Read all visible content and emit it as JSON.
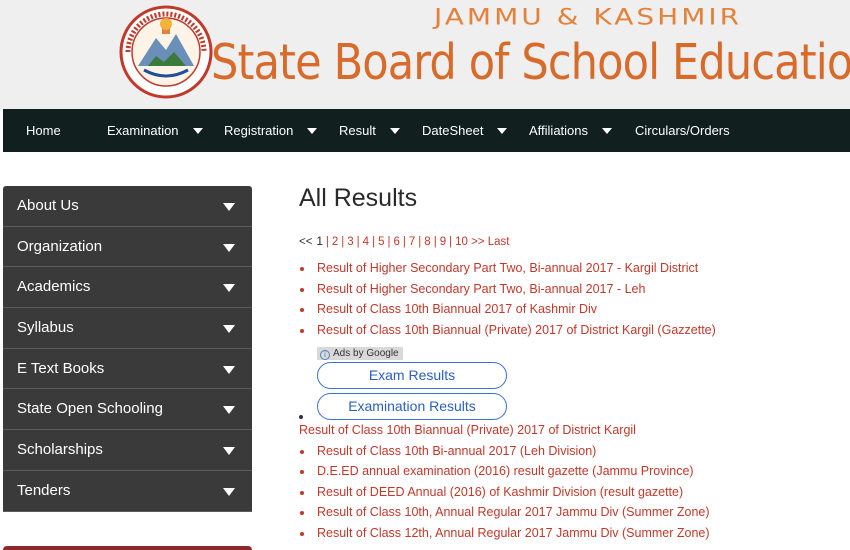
{
  "header": {
    "state_name": "JAMMU & KASHMIR",
    "board_name": "State Board of School Education"
  },
  "nav": [
    {
      "label": "Home",
      "dropdown": false
    },
    {
      "label": "Examination",
      "dropdown": true
    },
    {
      "label": "Registration",
      "dropdown": true
    },
    {
      "label": "Result",
      "dropdown": true
    },
    {
      "label": "DateSheet",
      "dropdown": true
    },
    {
      "label": "Affiliations",
      "dropdown": true
    },
    {
      "label": "Circulars/Orders",
      "dropdown": false
    }
  ],
  "sidebar": {
    "items": [
      {
        "label": "About Us"
      },
      {
        "label": "Organization"
      },
      {
        "label": "Academics"
      },
      {
        "label": "Syllabus"
      },
      {
        "label": "E Text Books"
      },
      {
        "label": "State Open Schooling"
      },
      {
        "label": "Scholarships"
      },
      {
        "label": "Tenders"
      }
    ]
  },
  "main": {
    "title": "All Results",
    "pager": {
      "first": "<<",
      "current": "1",
      "pages": [
        "2",
        "3",
        "4",
        "5",
        "6",
        "7",
        "8",
        "9",
        "10"
      ],
      "next": ">>",
      "last": "Last"
    },
    "results_top": [
      "Result of Higher Secondary Part Two, Bi-annual 2017 - Kargil District",
      "Result of Higher Secondary Part Two, Bi-annual 2017 - Leh",
      "Result of Class 10th Biannual 2017 of Kashmir Div",
      "Result of Class 10th Biannual (Private) 2017 of District Kargil (Gazzette)"
    ],
    "ads": {
      "label": "Ads by Google",
      "buttons": [
        "Exam Results",
        "Examination Results"
      ]
    },
    "result_after_ads": "Result of Class 10th Biannual (Private) 2017 of District Kargil",
    "results_bottom": [
      "Result of Class 10th Bi-annual 2017 (Leh Division)",
      "D.E.ED annual examination (2016) result gazette (Jammu Province)",
      "Result of DEED Annual (2016) of Kashmir Division (result gazette)",
      "Result of Class 10th, Annual Regular 2017 Jammu Div (Summer Zone)",
      "Result of Class 12th, Annual Regular 2017 Jammu Div (Summer Zone)"
    ]
  },
  "colors": {
    "nav_bg": "#11201f",
    "sidebar_bg": "#3a3a3a",
    "link": "#c0392b",
    "header_text": "#d86a2a"
  }
}
